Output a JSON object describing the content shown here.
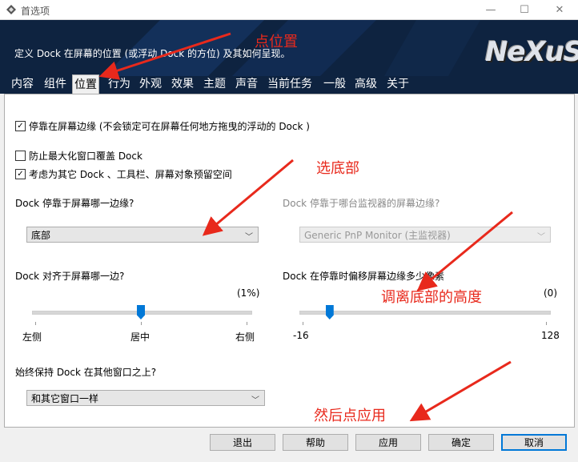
{
  "window": {
    "title": "首选项"
  },
  "banner": {
    "description": "定义 Dock 在屏幕的位置 (或浮动 Dock 的方位) 及其如何呈现。",
    "logo": "NeXuS"
  },
  "tabs": [
    {
      "label": "内容"
    },
    {
      "label": "组件"
    },
    {
      "label": "位置",
      "active": true
    },
    {
      "label": "行为"
    },
    {
      "label": "外观"
    },
    {
      "label": "效果"
    },
    {
      "label": "主题"
    },
    {
      "label": "声音"
    },
    {
      "label": "当前任务"
    },
    {
      "label": "一般"
    },
    {
      "label": "高级"
    },
    {
      "label": "关于"
    }
  ],
  "options": {
    "dock_edge": {
      "label": "停靠在屏幕边缘 (不会锁定可在屏幕任何地方拖曳的浮动的 Dock )",
      "checked": true
    },
    "prevent_max": {
      "label": "防止最大化窗口覆盖 Dock",
      "checked": false
    },
    "reserve_space": {
      "label": "考虑为其它 Dock 、工具栏、屏幕对象预留空间",
      "checked": true
    }
  },
  "edge": {
    "label": "Dock 停靠于屏幕哪一边缘?",
    "value": "底部"
  },
  "monitor": {
    "label": "Dock 停靠于哪台监视器的屏幕边缘?",
    "value": "Generic PnP Monitor (主监视器)"
  },
  "align": {
    "label": "Dock 对齐于屏幕哪一边?",
    "value_text": "(1%)",
    "fraction": 0.5,
    "left": "左侧",
    "center": "居中",
    "right": "右侧"
  },
  "offset": {
    "label": "Dock 在停靠时偏移屏幕边缘多少像素",
    "value_text": "(0)",
    "min": "-16",
    "max": "128",
    "value": 0
  },
  "ontop": {
    "label": "始终保持 Dock 在其他窗口之上?",
    "value": "和其它窗口一样"
  },
  "buttons": {
    "exit": "退出",
    "help": "帮助",
    "apply": "应用",
    "ok": "确定",
    "cancel": "取消"
  },
  "annotations": {
    "a1": "点位置",
    "a2": "选底部",
    "a3": "调离底部的高度",
    "a4": "然后点应用"
  },
  "colors": {
    "accent": "#0078d7",
    "banner": "#0e2340",
    "annotation": "#e8291c"
  }
}
